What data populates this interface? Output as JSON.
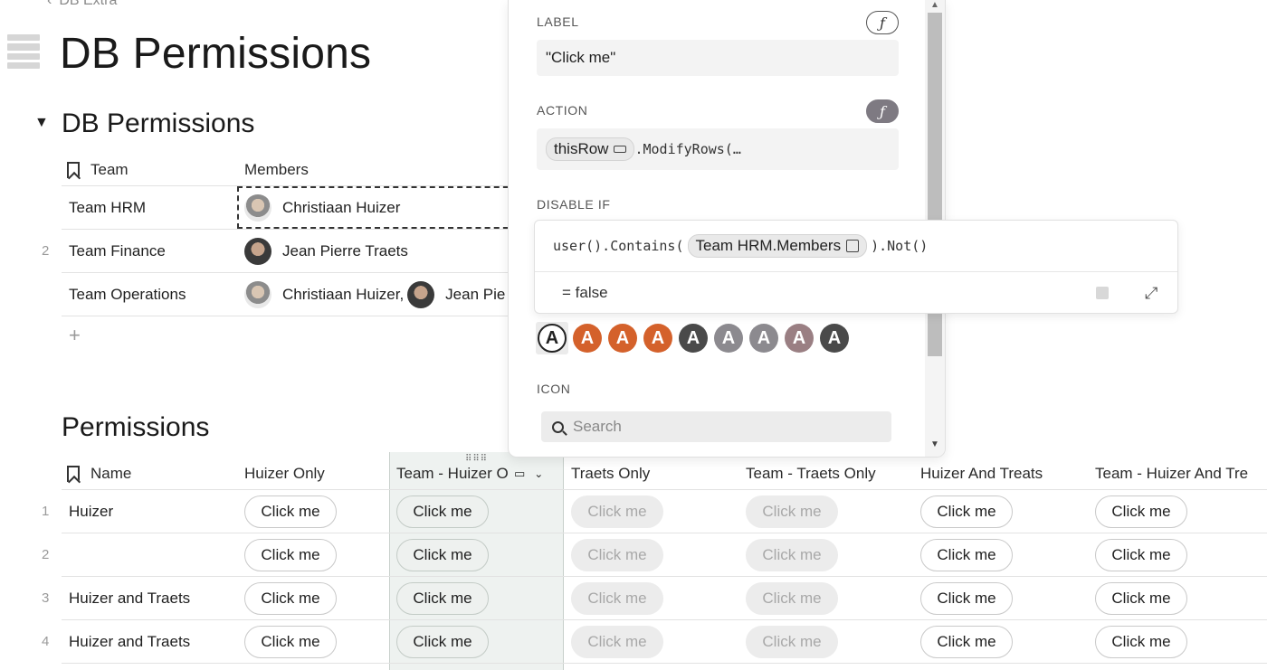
{
  "breadcrumb": {
    "parent": "DB Extra"
  },
  "page": {
    "title": "DB Permissions"
  },
  "section1": {
    "title": "DB Permissions",
    "headers": {
      "team": "Team",
      "members": "Members"
    },
    "rows": [
      {
        "num": "",
        "team": "Team HRM",
        "members": [
          {
            "name": "Christiaan Huizer",
            "avatar": "christiaan"
          }
        ]
      },
      {
        "num": "2",
        "team": "Team Finance",
        "members": [
          {
            "name": "Jean Pierre Traets",
            "avatar": "jean"
          }
        ]
      },
      {
        "num": "",
        "team": "Team Operations",
        "members": [
          {
            "name": "Christiaan Huizer,",
            "avatar": "christiaan"
          },
          {
            "name": "Jean Pie",
            "avatar": "jean"
          }
        ]
      }
    ],
    "add": "+"
  },
  "section2": {
    "title": "Permissions",
    "headers": [
      "Name",
      "Huizer Only",
      "Team - Huizer O",
      "Traets Only",
      "Team - Traets Only",
      "Huizer And Treats",
      "Team - Huizer And Tre"
    ],
    "button_label": "Click me",
    "rows": [
      {
        "num": "1",
        "name": "Huizer"
      },
      {
        "num": "2",
        "name": ""
      },
      {
        "num": "3",
        "name": "Huizer and Traets"
      },
      {
        "num": "4",
        "name": "Huizer and Traets"
      }
    ]
  },
  "panel": {
    "label_title": "LABEL",
    "label_value": "\"Click me\"",
    "action_title": "ACTION",
    "action_chip": "thisRow",
    "action_rest": ".ModifyRows(…",
    "disable_title": "DISABLE IF",
    "icon_title": "ICON",
    "search_placeholder": "Search",
    "fx": "ƒ",
    "letters": [
      "A",
      "A",
      "A",
      "A",
      "A",
      "A",
      "A",
      "A",
      "A"
    ],
    "letter_colors": [
      "#ffffff",
      "#d4612b",
      "#d4612b",
      "#d4612b",
      "#4a4a4a",
      "#8c8a8f",
      "#8c8a8f",
      "#9a7f83",
      "#4a4a4a"
    ]
  },
  "formula": {
    "prefix": "user().Contains(",
    "chip": "Team HRM.Members",
    "suffix": ").Not()",
    "result": "=  false"
  }
}
